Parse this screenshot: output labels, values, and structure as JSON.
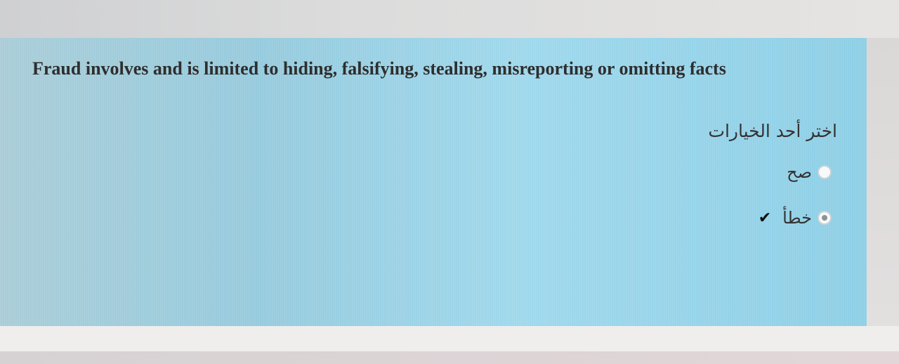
{
  "question": {
    "text": "Fraud involves and is limited to hiding, falsifying, stealing, misreporting or omitting facts",
    "instruction": "اختر أحد الخيارات"
  },
  "options": [
    {
      "label": "صح",
      "selected": false,
      "marked_correct": false
    },
    {
      "label": "خطأ",
      "selected": true,
      "marked_correct": true,
      "mark_icon": "checkmark-icon"
    }
  ],
  "colors": {
    "panel": "#9fd8ec",
    "text": "#2e2e2e",
    "checkmark": "#111111"
  }
}
